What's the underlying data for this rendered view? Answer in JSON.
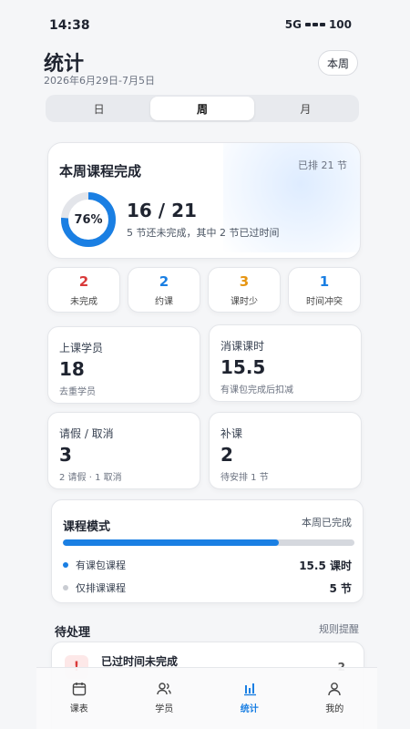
{
  "status": {
    "time": "14:38",
    "network": "5G",
    "battery": "100"
  },
  "header": {
    "title": "统计",
    "date_range": "2026年6月29日-7月5日",
    "period_button": "本周"
  },
  "segment": {
    "tabs": [
      "日",
      "周",
      "月"
    ],
    "active": "周"
  },
  "hero": {
    "title": "本周课程完成",
    "scheduled": "已排 21 节",
    "percent_label": "76%",
    "percent": 76,
    "count": "16 / 21",
    "note": "5 节还未完成，其中 2 节已过时间"
  },
  "stats": [
    {
      "value": "2",
      "label": "未完成",
      "color": "#d93a3a"
    },
    {
      "value": "2",
      "label": "约课",
      "color": "#1a7fe3"
    },
    {
      "value": "3",
      "label": "课时少",
      "color": "#e69512"
    },
    {
      "value": "1",
      "label": "时间冲突",
      "color": "#1a7fe3"
    }
  ],
  "metrics": [
    {
      "label": "上课学员",
      "value": "18",
      "sub": "去重学员"
    },
    {
      "label": "消课课时",
      "value": "15.5",
      "sub": "有课包完成后扣减"
    },
    {
      "label": "请假 / 取消",
      "value": "3",
      "sub": "2 请假 · 1 取消"
    },
    {
      "label": "补课",
      "value": "2",
      "sub": "待安排 1 节"
    }
  ],
  "mode": {
    "title": "课程模式",
    "status": "本周已完成",
    "progress_percent": 74,
    "rows": [
      {
        "label": "有课包课程",
        "value": "15.5 课时",
        "dot_color": "#1a7fe3"
      },
      {
        "label": "仅排课课程",
        "value": "5 节",
        "dot_color": "#c9ccd2"
      }
    ]
  },
  "pending": {
    "title": "待处理",
    "link": "规则提醒",
    "items": [
      {
        "badge": "!",
        "title": "已过时间未完成",
        "count": "2"
      }
    ]
  },
  "nav": {
    "items": [
      {
        "label": "课表",
        "icon": "calendar-icon"
      },
      {
        "label": "学员",
        "icon": "users-icon"
      },
      {
        "label": "统计",
        "icon": "bar-chart-icon"
      },
      {
        "label": "我的",
        "icon": "profile-icon"
      }
    ],
    "active": "统计",
    "active_color": "#1a7fe3"
  }
}
